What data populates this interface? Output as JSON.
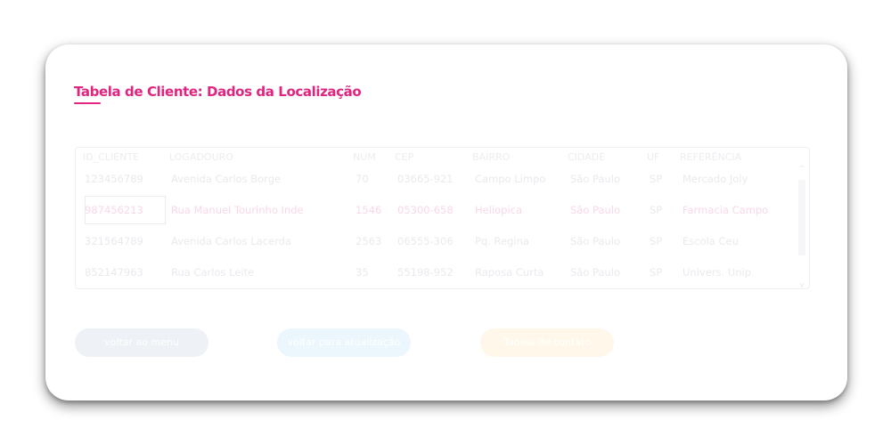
{
  "title": "Tabela de Cliente: Dados da Localização",
  "table": {
    "headers": [
      "ID_CLIENTE",
      "LOGADOURO",
      "NÚM",
      "CEP",
      "BAIRRO",
      "CIDADE",
      "UF",
      "REFERÊNCIA"
    ],
    "rows": [
      [
        "123456789",
        "Avenida Carlos Borge",
        "70",
        "03665-921",
        "Campo Limpo",
        "São Paulo",
        "SP",
        "Mercado Joly"
      ],
      [
        "987456213",
        "Rua Manuel Tourinho Inde",
        "1546",
        "05300-658",
        "Heliopica",
        "São Paulo",
        "SP",
        "Farmacia Campo"
      ],
      [
        "321564789",
        "Avenida Carlos Lacerda",
        "2563",
        "06555-306",
        "Pq. Regina",
        "São Paulo",
        "SP",
        "Escola Ceu"
      ],
      [
        "852147963",
        "Rua Carlos Leite",
        "35",
        "55198-952",
        "Raposa Curta",
        "São Paulo",
        "SP",
        "Univers. Unip"
      ]
    ],
    "selected_row": 1,
    "scroll_up_glyph": "^",
    "scroll_down_glyph": "v"
  },
  "buttons": {
    "back_menu": "voltar ao menu",
    "back_update": "voltar para atualização",
    "contact_table": "Tabela de contato"
  },
  "colors": {
    "accent": "#e0247f"
  }
}
